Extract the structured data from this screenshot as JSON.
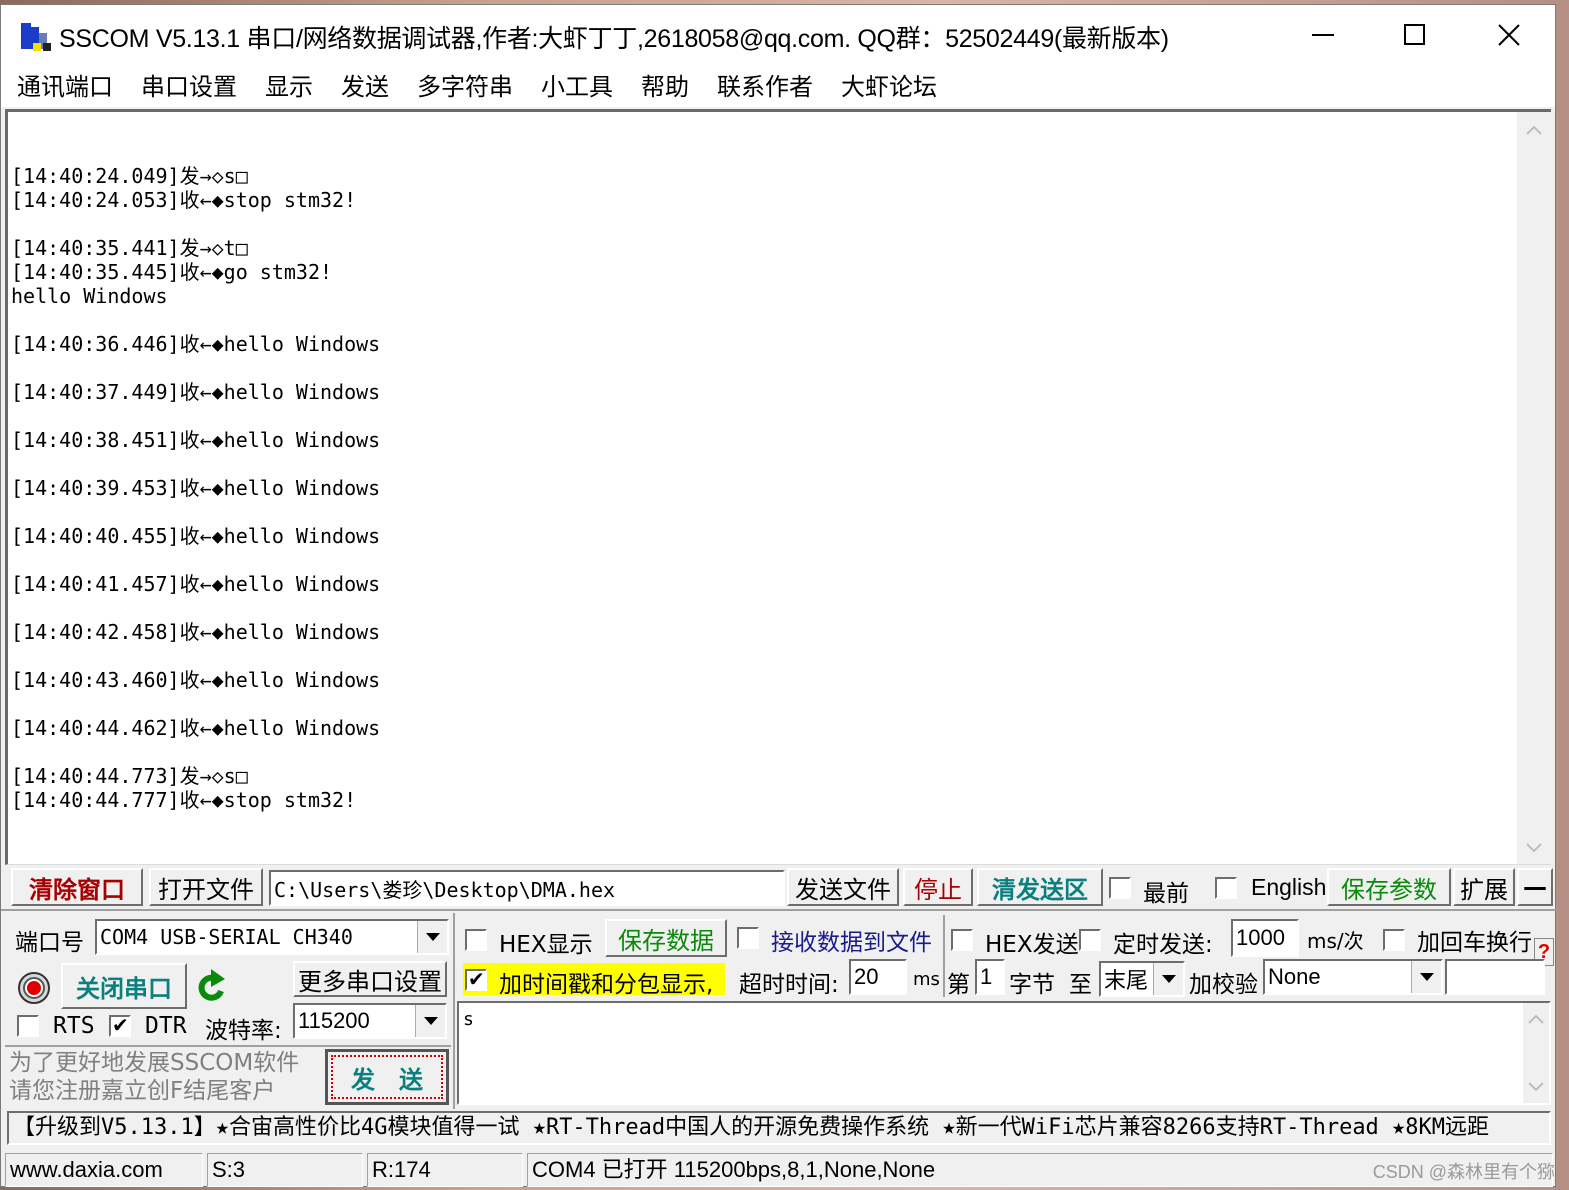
{
  "window": {
    "title": "SSCOM V5.13.1 串口/网络数据调试器,作者:大虾丁丁,2618058@qq.com. QQ群：52502449(最新版本)"
  },
  "menu": [
    "通讯端口",
    "串口设置",
    "显示",
    "发送",
    "多字符串",
    "小工具",
    "帮助",
    "联系作者",
    "大虾论坛"
  ],
  "receive_log": [
    "",
    "[14:40:24.049]发→◇s□",
    "[14:40:24.053]收←◆stop stm32!",
    "",
    "[14:40:35.441]发→◇t□",
    "[14:40:35.445]收←◆go stm32!",
    "hello Windows",
    "",
    "[14:40:36.446]收←◆hello Windows",
    "",
    "[14:40:37.449]收←◆hello Windows",
    "",
    "[14:40:38.451]收←◆hello Windows",
    "",
    "[14:40:39.453]收←◆hello Windows",
    "",
    "[14:40:40.455]收←◆hello Windows",
    "",
    "[14:40:41.457]收←◆hello Windows",
    "",
    "[14:40:42.458]收←◆hello Windows",
    "",
    "[14:40:43.460]收←◆hello Windows",
    "",
    "[14:40:44.462]收←◆hello Windows",
    "",
    "[14:40:44.773]发→◇s□",
    "[14:40:44.777]收←◆stop stm32!"
  ],
  "toolbar": {
    "clear_window": "清除窗口",
    "open_file": "打开文件",
    "file_path": "C:\\Users\\娄珍\\Desktop\\DMA.hex",
    "send_file": "发送文件",
    "stop": "停止",
    "clear_send": "清发送区",
    "topmost_label": "最前",
    "topmost_checked": false,
    "english_label": "English",
    "english_checked": false,
    "save_params": "保存参数",
    "expand": "扩展",
    "collapse": "—"
  },
  "port": {
    "port_label": "端口号",
    "port_value": "COM4 USB-SERIAL CH340",
    "close_port": "关闭串口",
    "more_settings": "更多串口设置",
    "rts_label": "RTS",
    "rts_checked": false,
    "dtr_label": "DTR",
    "dtr_checked": true,
    "baud_label": "波特率:",
    "baud_value": "115200",
    "promo_line1": "为了更好地发展SSCOM软件",
    "promo_line2": "请您注册嘉立创F结尾客户",
    "send_button": "发　送"
  },
  "options": {
    "hex_display_label": "HEX显示",
    "hex_display_checked": false,
    "save_data": "保存数据",
    "recv_to_file_label": "接收数据到文件",
    "recv_to_file_checked": false,
    "hex_send_label": "HEX发送",
    "hex_send_checked": false,
    "timed_send_label": "定时发送:",
    "timed_send_checked": false,
    "timed_interval": "1000",
    "interval_unit": "ms/次",
    "add_crlf_label": "加回车换行",
    "add_crlf_checked": false,
    "timestamp_label": "加时间戳和分包显示,",
    "timestamp_checked": true,
    "timeout_label": "超时时间:",
    "timeout_value": "20",
    "timeout_unit": "ms",
    "byte_from_label": "第",
    "byte_from_value": "1",
    "byte_label": "字节",
    "to_label": "至",
    "to_value": "末尾",
    "checksum_label": "加校验",
    "checksum_value": "None",
    "help": "?"
  },
  "send_area": {
    "content": "s"
  },
  "ticker": "【升级到V5.13.1】★合宙高性价比4G模块值得一试 ★RT-Thread中国人的开源免费操作系统 ★新一代WiFi芯片兼容8266支持RT-Thread ★8KM远距",
  "status": {
    "website": "www.daxia.com",
    "sent": "S:3",
    "received": "R:174",
    "port_state": "COM4 已打开  115200bps,8,1,None,None"
  },
  "watermark": "CSDN @森林里有个猕",
  "colors": {
    "clear_window": "#a80000",
    "stop": "#a80000",
    "close_port": "#0a7f7f",
    "clear_send": "#0a7f7f",
    "save_green": "#0a8a0a",
    "recv_to_file": "#1a1a8c",
    "timestamp_highlight": "#ffff00"
  }
}
